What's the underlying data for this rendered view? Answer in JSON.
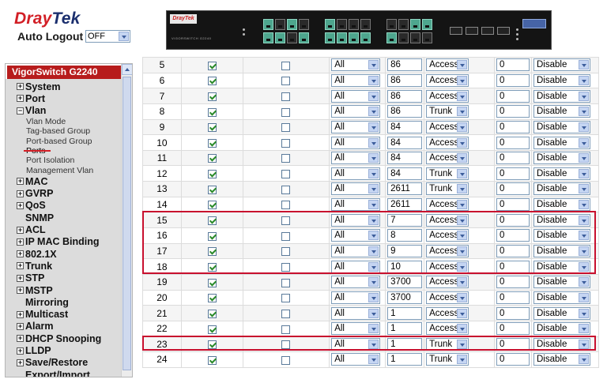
{
  "header": {
    "logo_dray": "Dray",
    "logo_tek": "Tek",
    "auto_logout_label": "Auto Logout",
    "auto_logout_value": "OFF",
    "switch_brand": "DrayTek",
    "switch_model": "VIGORSWITCH G2240"
  },
  "sidebar": {
    "title": "VigorSwitch G2240",
    "items": [
      {
        "label": "System",
        "type": "group",
        "icon": "plus"
      },
      {
        "label": "Port",
        "type": "group",
        "icon": "plus"
      },
      {
        "label": "Vlan",
        "type": "group",
        "icon": "minus"
      },
      {
        "label": "Vlan Mode",
        "type": "sub"
      },
      {
        "label": "Tag-based Group",
        "type": "sub"
      },
      {
        "label": "Port-based Group",
        "type": "sub"
      },
      {
        "label": "Ports",
        "type": "sub",
        "active": true
      },
      {
        "label": "Port Isolation",
        "type": "sub"
      },
      {
        "label": "Management Vlan",
        "type": "sub"
      },
      {
        "label": "MAC",
        "type": "group",
        "icon": "plus"
      },
      {
        "label": "GVRP",
        "type": "group",
        "icon": "plus"
      },
      {
        "label": "QoS",
        "type": "group",
        "icon": "plus"
      },
      {
        "label": "SNMP",
        "type": "group",
        "icon": "none"
      },
      {
        "label": "ACL",
        "type": "group",
        "icon": "plus"
      },
      {
        "label": "IP MAC Binding",
        "type": "group",
        "icon": "plus"
      },
      {
        "label": "802.1X",
        "type": "group",
        "icon": "plus"
      },
      {
        "label": "Trunk",
        "type": "group",
        "icon": "plus"
      },
      {
        "label": "STP",
        "type": "group",
        "icon": "plus"
      },
      {
        "label": "MSTP",
        "type": "group",
        "icon": "plus"
      },
      {
        "label": "Mirroring",
        "type": "group",
        "icon": "none"
      },
      {
        "label": "Multicast",
        "type": "group",
        "icon": "plus"
      },
      {
        "label": "Alarm",
        "type": "group",
        "icon": "plus"
      },
      {
        "label": "DHCP Snooping",
        "type": "group",
        "icon": "plus"
      },
      {
        "label": "LLDP",
        "type": "group",
        "icon": "plus"
      },
      {
        "label": "Save/Restore",
        "type": "group",
        "icon": "plus"
      },
      {
        "label": "Export/Import",
        "type": "group",
        "icon": "none"
      }
    ]
  },
  "table": {
    "rows": [
      {
        "port": "5",
        "enabled": true,
        "second": false,
        "accept": "All",
        "pvid": "86",
        "mode": "Access",
        "num": "0",
        "state": "Disable"
      },
      {
        "port": "6",
        "enabled": true,
        "second": false,
        "accept": "All",
        "pvid": "86",
        "mode": "Access",
        "num": "0",
        "state": "Disable"
      },
      {
        "port": "7",
        "enabled": true,
        "second": false,
        "accept": "All",
        "pvid": "86",
        "mode": "Access",
        "num": "0",
        "state": "Disable"
      },
      {
        "port": "8",
        "enabled": true,
        "second": false,
        "accept": "All",
        "pvid": "86",
        "mode": "Trunk",
        "num": "0",
        "state": "Disable"
      },
      {
        "port": "9",
        "enabled": true,
        "second": false,
        "accept": "All",
        "pvid": "84",
        "mode": "Access",
        "num": "0",
        "state": "Disable"
      },
      {
        "port": "10",
        "enabled": true,
        "second": false,
        "accept": "All",
        "pvid": "84",
        "mode": "Access",
        "num": "0",
        "state": "Disable"
      },
      {
        "port": "11",
        "enabled": true,
        "second": false,
        "accept": "All",
        "pvid": "84",
        "mode": "Access",
        "num": "0",
        "state": "Disable"
      },
      {
        "port": "12",
        "enabled": true,
        "second": false,
        "accept": "All",
        "pvid": "84",
        "mode": "Trunk",
        "num": "0",
        "state": "Disable"
      },
      {
        "port": "13",
        "enabled": true,
        "second": false,
        "accept": "All",
        "pvid": "2611",
        "mode": "Trunk",
        "num": "0",
        "state": "Disable"
      },
      {
        "port": "14",
        "enabled": true,
        "second": false,
        "accept": "All",
        "pvid": "2611",
        "mode": "Access",
        "num": "0",
        "state": "Disable"
      },
      {
        "port": "15",
        "enabled": true,
        "second": false,
        "accept": "All",
        "pvid": "7",
        "mode": "Access",
        "num": "0",
        "state": "Disable"
      },
      {
        "port": "16",
        "enabled": true,
        "second": false,
        "accept": "All",
        "pvid": "8",
        "mode": "Access",
        "num": "0",
        "state": "Disable"
      },
      {
        "port": "17",
        "enabled": true,
        "second": false,
        "accept": "All",
        "pvid": "9",
        "mode": "Access",
        "num": "0",
        "state": "Disable"
      },
      {
        "port": "18",
        "enabled": true,
        "second": false,
        "accept": "All",
        "pvid": "10",
        "mode": "Access",
        "num": "0",
        "state": "Disable"
      },
      {
        "port": "19",
        "enabled": true,
        "second": false,
        "accept": "All",
        "pvid": "3700",
        "mode": "Access",
        "num": "0",
        "state": "Disable"
      },
      {
        "port": "20",
        "enabled": true,
        "second": false,
        "accept": "All",
        "pvid": "3700",
        "mode": "Access",
        "num": "0",
        "state": "Disable"
      },
      {
        "port": "21",
        "enabled": true,
        "second": false,
        "accept": "All",
        "pvid": "1",
        "mode": "Access",
        "num": "0",
        "state": "Disable"
      },
      {
        "port": "22",
        "enabled": true,
        "second": false,
        "accept": "All",
        "pvid": "1",
        "mode": "Access",
        "num": "0",
        "state": "Disable"
      },
      {
        "port": "23",
        "enabled": true,
        "second": false,
        "accept": "All",
        "pvid": "1",
        "mode": "Trunk",
        "num": "0",
        "state": "Disable"
      },
      {
        "port": "24",
        "enabled": true,
        "second": false,
        "accept": "All",
        "pvid": "1",
        "mode": "Trunk",
        "num": "0",
        "state": "Disable"
      }
    ],
    "highlighted_ports": [
      "15",
      "16",
      "17",
      "18",
      "23"
    ]
  },
  "colors": {
    "brand_red": "#d21f26",
    "brand_blue": "#1b2f6e",
    "highlight_red": "#c8102e",
    "sidebar_title_bg": "#b71c1c",
    "sidebar_bg": "#dcdcdc"
  }
}
